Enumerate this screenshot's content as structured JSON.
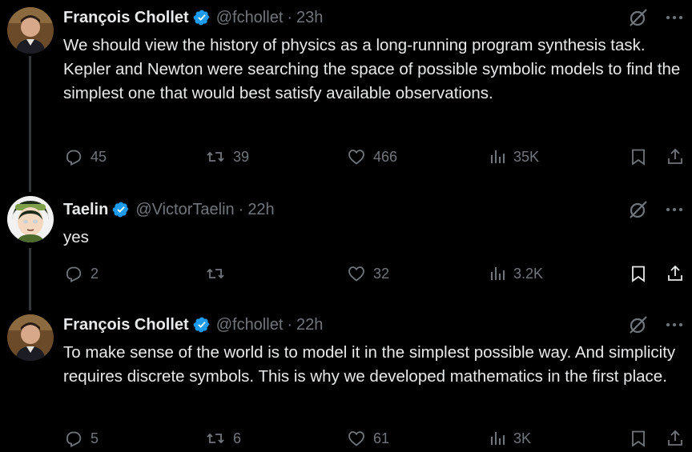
{
  "colors": {
    "background": "#000000",
    "text": "#e7e9ea",
    "secondary": "#71767b",
    "verified": "#1d9bf0",
    "thread_line": "#333639"
  },
  "tweets": [
    {
      "name": "François Chollet",
      "handle": "@fchollet",
      "separator": "·",
      "time": "23h",
      "text": "We should view the history of physics as a long-running program synthesis task. Kepler and Newton were searching the space of possible symbolic models to find the simplest one that would best satisfy available observations.",
      "replies": "45",
      "reposts": "39",
      "likes": "466",
      "views": "35K",
      "avatar_icon": "profile-photo-chollet"
    },
    {
      "name": "Taelin",
      "handle": "@VictorTaelin",
      "separator": "·",
      "time": "22h",
      "text": "yes",
      "replies": "2",
      "reposts": "",
      "likes": "32",
      "views": "3.2K",
      "avatar_icon": "cartoon-avatar-taelin"
    },
    {
      "name": "François Chollet",
      "handle": "@fchollet",
      "separator": "·",
      "time": "22h",
      "text": "To make sense of the world is to model it in the simplest possible way. And simplicity requires discrete symbols. This is why we developed mathematics in the first place.",
      "replies": "5",
      "reposts": "6",
      "likes": "61",
      "views": "3K",
      "avatar_icon": "profile-photo-chollet"
    }
  ]
}
